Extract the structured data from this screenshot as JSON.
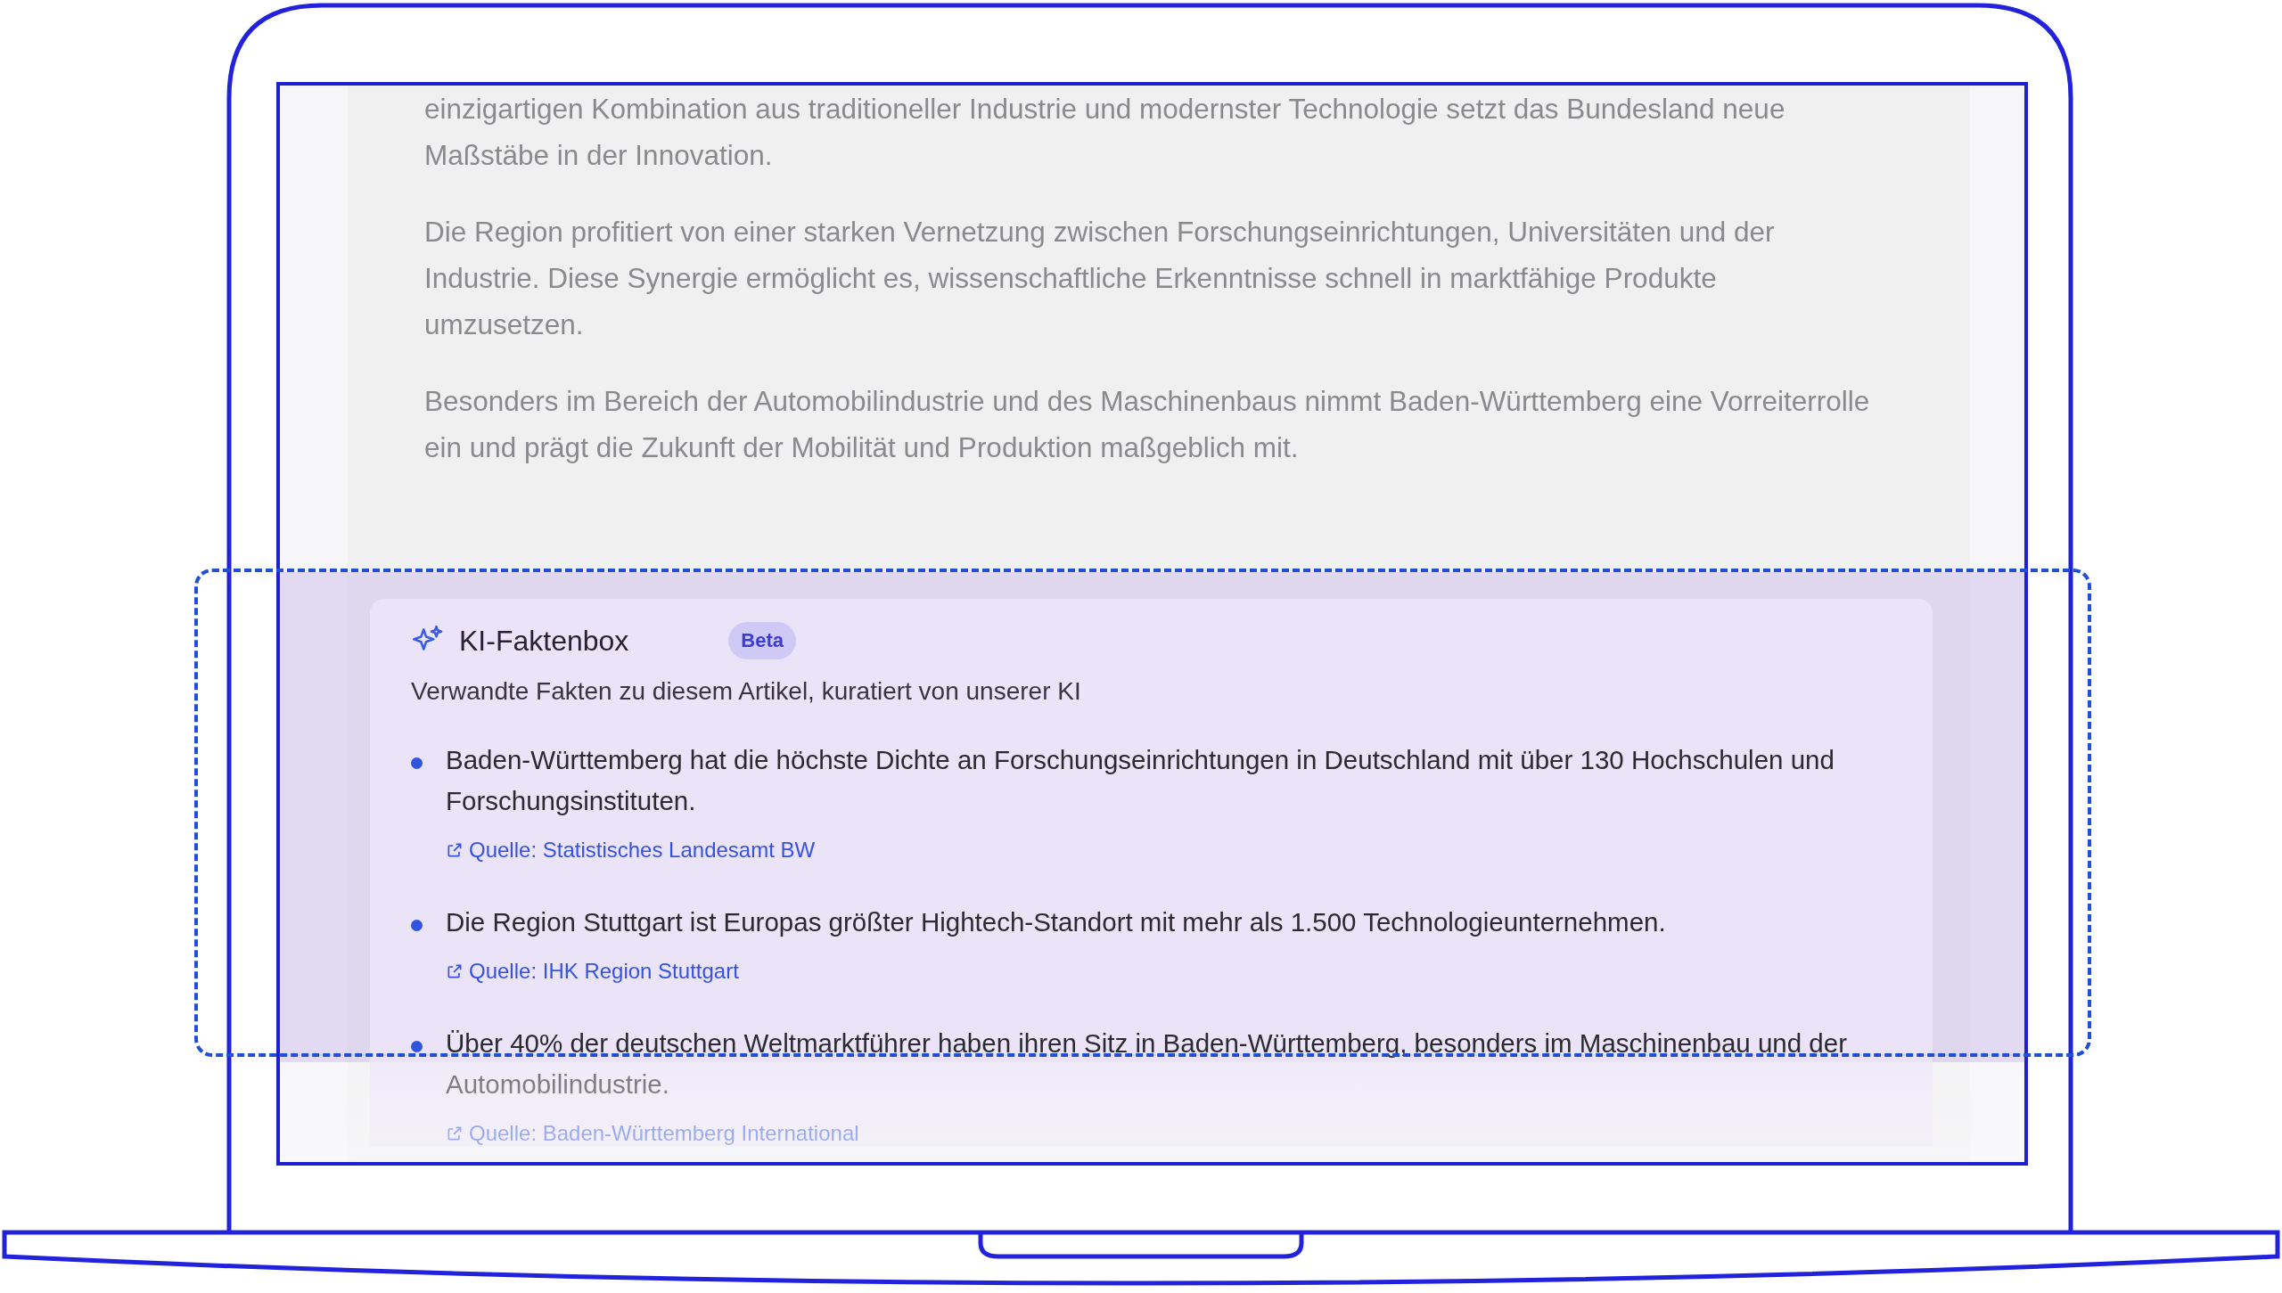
{
  "article": {
    "paragraphs": [
      "einzigartigen Kombination aus traditioneller Industrie und modernster Technologie setzt das Bundesland neue Maßstäbe in der Innovation.",
      "Die Region profitiert von einer starken Vernetzung zwischen Forschungseinrichtungen, Universitäten und der Industrie. Diese Synergie ermöglicht es, wissenschaftliche Erkenntnisse schnell in marktfähige Produkte umzusetzen.",
      "Besonders im Bereich der Automobilindustrie und des Maschinenbaus nimmt Baden-Württemberg eine Vorreiterrolle ein und prägt die Zukunft der Mobilität und Produktion maßgeblich mit."
    ]
  },
  "fact_box": {
    "title": "KI-Faktenbox",
    "badge": "Beta",
    "subtitle": "Verwandte Fakten zu diesem Artikel, kuratiert von unserer KI",
    "facts": [
      {
        "text": "Baden-Württemberg hat die höchste Dichte an Forschungseinrichtungen in Deutschland mit über 130 Hochschulen und Forschungsinstituten.",
        "source": "Quelle: Statistisches Landesamt BW"
      },
      {
        "text": "Die Region Stuttgart ist Europas größter Hightech-Standort mit mehr als 1.500 Technologieunternehmen.",
        "source": "Quelle: IHK Region Stuttgart"
      },
      {
        "text": "Über 40% der deutschen Weltmarktführer haben ihren Sitz in Baden-Württemberg, besonders im Maschinenbau und der Automobilindustrie.",
        "source": "Quelle: Baden-Württemberg International"
      }
    ]
  }
}
